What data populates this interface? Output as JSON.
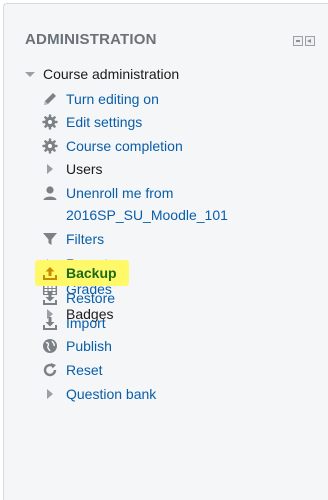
{
  "block": {
    "title": "ADMINISTRATION",
    "controls": {
      "hide_icon": "minus-square-icon",
      "dock_icon": "dock-left-icon"
    }
  },
  "tree": {
    "root": {
      "label": "Course administration",
      "icon": "triangle-down-icon"
    },
    "items": [
      {
        "label": "Turn editing on",
        "icon": "pencil-icon",
        "type": "link"
      },
      {
        "label": "Edit settings",
        "icon": "gear-icon",
        "type": "link"
      },
      {
        "label": "Course completion",
        "icon": "gear-icon",
        "type": "link"
      },
      {
        "label": "Users",
        "icon": "triangle-right-icon",
        "type": "branch"
      },
      {
        "label": "Unenroll me from",
        "label2": "2016SP_SU_Moodle_101",
        "icon": "user-icon",
        "type": "link"
      },
      {
        "label": "Filters",
        "icon": "filter-icon",
        "type": "link"
      },
      {
        "label": "Reports",
        "icon": "triangle-right-icon",
        "type": "branch"
      },
      {
        "label": "Grades",
        "icon": "grades-table-icon",
        "type": "link"
      },
      {
        "label": "Badges",
        "icon": "triangle-right-icon",
        "type": "branch"
      },
      {
        "label": "Backup",
        "icon": "upload-icon",
        "type": "link",
        "highlighted": true
      },
      {
        "label": "Restore",
        "icon": "download-icon",
        "type": "link"
      },
      {
        "label": "Import",
        "icon": "download-icon",
        "type": "link"
      },
      {
        "label": "Publish",
        "icon": "globe-icon",
        "type": "link"
      },
      {
        "label": "Reset",
        "icon": "reset-icon",
        "type": "link"
      },
      {
        "label": "Question bank",
        "icon": "triangle-right-icon",
        "type": "branch"
      }
    ]
  },
  "colors": {
    "link": "#0a5ea8",
    "text": "#1b1b1b",
    "highlight": "#fff96a",
    "highlight_text": "#1a6a1a",
    "block_bg": "#f4f6f8"
  }
}
